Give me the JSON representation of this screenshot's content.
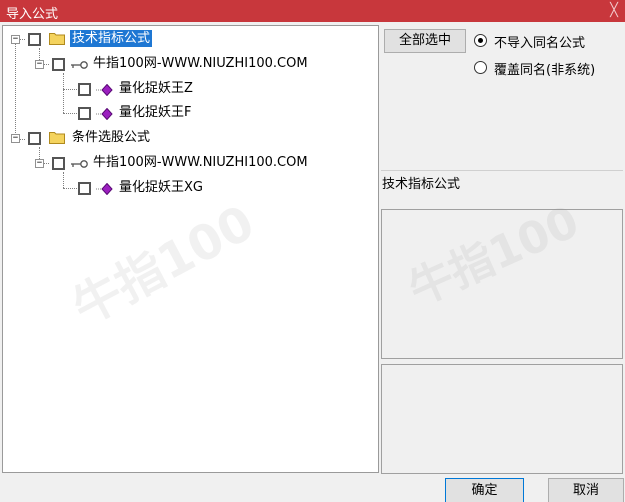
{
  "window": {
    "title": "导入公式",
    "close_glyph": "╳"
  },
  "tree": {
    "groups": [
      {
        "label": "技术指标公式",
        "expander": "−",
        "selected": true,
        "children": [
          {
            "label": "牛指100网-WWW.NIUZHI100.COM",
            "expander": "−",
            "children": [
              {
                "label": "量化捉妖王Z"
              },
              {
                "label": "量化捉妖王F"
              }
            ]
          }
        ]
      },
      {
        "label": "条件选股公式",
        "expander": "−",
        "selected": false,
        "children": [
          {
            "label": "牛指100网-WWW.NIUZHI100.COM",
            "expander": "−",
            "children": [
              {
                "label": "量化捉妖王XG"
              }
            ]
          }
        ]
      }
    ]
  },
  "options": {
    "select_all_label": "全部选中",
    "radio_options": [
      {
        "label": "不导入同名公式",
        "checked": true
      },
      {
        "label": "覆盖同名(非系统)",
        "checked": false
      }
    ]
  },
  "detail": {
    "category_label": "技术指标公式"
  },
  "footer": {
    "ok_label": "确定",
    "cancel_label": "取消"
  },
  "colors": {
    "titlebar": "#c8373c",
    "selection": "#1e77d3",
    "folder": "#f4d35e",
    "gem": "#9b1fbf"
  },
  "icons": {
    "folder": "folder-icon",
    "key": "key-icon",
    "gem": "gem-icon",
    "close": "close-icon"
  }
}
